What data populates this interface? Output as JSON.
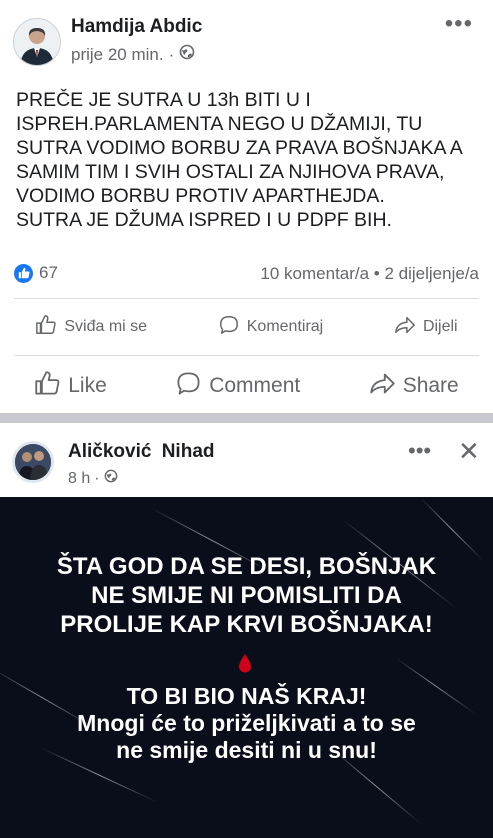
{
  "post1": {
    "author": "Hamdija Abdic",
    "time": "prije 20 min.",
    "separator": "·",
    "body_lines": [
      "PREČE JE SUTRA U 13h BITI U I",
      "ISPREH.PARLAMENTA NEGO U DŽAMIJI, TU",
      "SUTRA VODIMO BORBU ZA PRAVA BOŠNJAKA A",
      "SAMIM TIM I SVIH OSTALI ZA NJIHOVA PRAVA,",
      "VODIMO BORBU PROTIV APARTHEJDA.",
      "SUTRA JE DŽUMA ISPRED I U PDPF BIH."
    ],
    "reaction_count": "67",
    "comments_shares": "10 komentar/a • 2 dijeljenje/a",
    "actions_local": {
      "like": "Sviđa mi se",
      "comment": "Komentiraj",
      "share": "Dijeli"
    },
    "actions_en": {
      "like": "Like",
      "comment": "Comment",
      "share": "Share"
    },
    "more": "•••"
  },
  "post2": {
    "author": "Aličković Nihad",
    "time": "8 h",
    "separator": "·",
    "more": "•••",
    "close": "✕",
    "image_text": {
      "block1": [
        "ŠTA GOD DA SE DESI, BOŠNJAK",
        "NE SMIJE NI POMISLITI DA",
        "PROLIJE KAP KRVI BOŠNJAKA!"
      ],
      "block2_title": "TO BI BIO NAŠ KRAJ!",
      "block2_lines": [
        "Mnogi će to priželjkivati a to se",
        "ne smije desiti ni u snu!"
      ]
    }
  },
  "colors": {
    "accent": "#1877f2",
    "secondary_text": "#65676b",
    "image_bg": "#0a0e1a",
    "blood_drop": "#d0021b"
  },
  "icons": [
    "globe-icon",
    "like-icon",
    "comment-icon",
    "share-icon",
    "more-icon",
    "close-icon",
    "blood-drop-icon"
  ]
}
